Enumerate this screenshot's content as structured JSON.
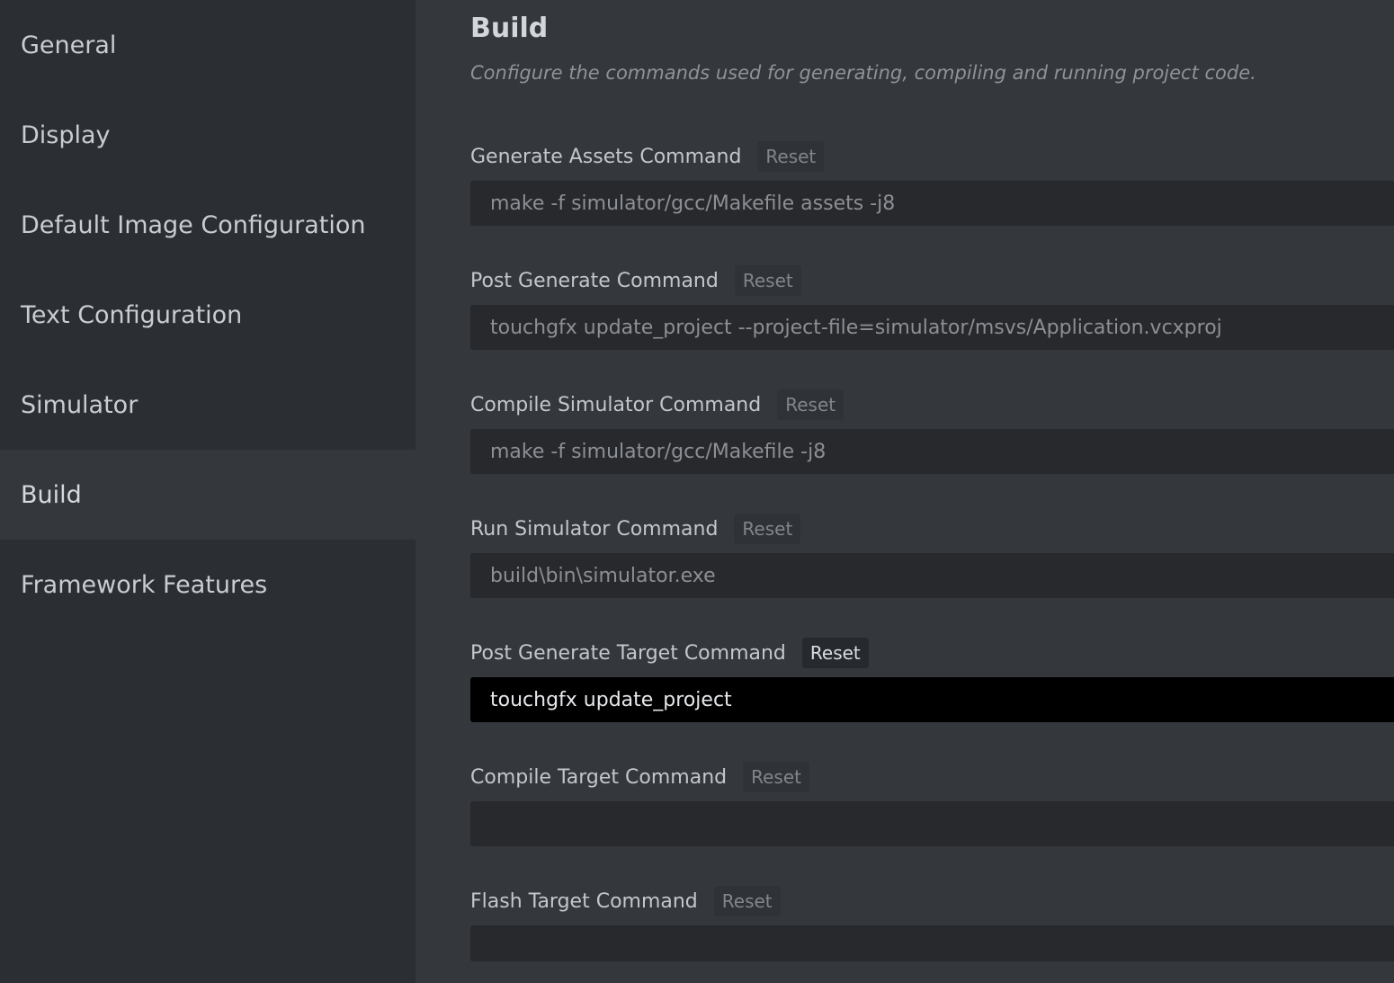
{
  "sidebar": {
    "items": [
      {
        "label": "General"
      },
      {
        "label": "Display"
      },
      {
        "label": "Default Image Configuration"
      },
      {
        "label": "Text Configuration"
      },
      {
        "label": "Simulator"
      },
      {
        "label": "Build",
        "active": true
      },
      {
        "label": "Framework Features"
      }
    ]
  },
  "main": {
    "title": "Build",
    "subtitle": "Configure the commands used for generating, compiling and running project code.",
    "fields": [
      {
        "label": "Generate Assets Command",
        "reset_label": "Reset",
        "value": "make -f simulator/gcc/Makefile assets -j8",
        "placeholder": ""
      },
      {
        "label": "Post Generate Command",
        "reset_label": "Reset",
        "value": "touchgfx update_project --project-file=simulator/msvs/Application.vcxproj",
        "placeholder": ""
      },
      {
        "label": "Compile Simulator Command",
        "reset_label": "Reset",
        "value": "make -f simulator/gcc/Makefile -j8",
        "placeholder": ""
      },
      {
        "label": "Run Simulator Command",
        "reset_label": "Reset",
        "value": "build\\bin\\simulator.exe",
        "placeholder": ""
      },
      {
        "label": "Post Generate Target Command",
        "reset_label": "Reset",
        "value": "touchgfx update_project",
        "placeholder": "",
        "focused": true
      },
      {
        "label": "Compile Target Command",
        "reset_label": "Reset",
        "value": "",
        "placeholder": ""
      },
      {
        "label": "Flash Target Command",
        "reset_label": "Reset",
        "value": "",
        "placeholder": ""
      }
    ]
  },
  "colors": {
    "sidebar_bg": "#2b2e33",
    "main_bg": "#34373c",
    "input_bg": "#27292d",
    "input_focused_bg": "#000000"
  }
}
